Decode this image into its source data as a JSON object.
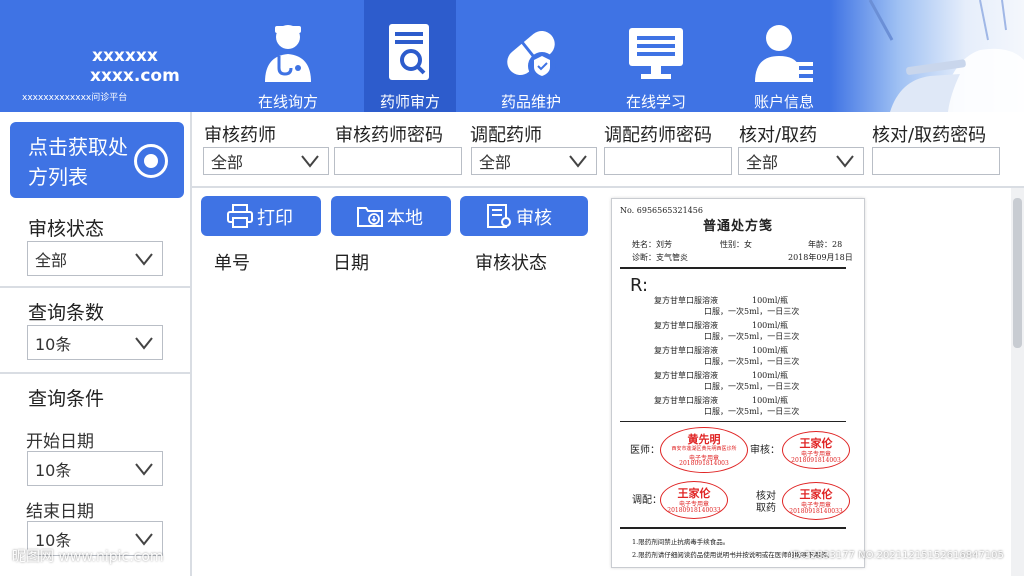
{
  "header": {
    "brand_line1": "xxxxxx",
    "brand_line2": "xxxx.com",
    "brand_sub": "xxxxxxxxxxxxx问诊平台",
    "nav": [
      {
        "label": "在线询方",
        "icon": "doctor-icon",
        "active": false
      },
      {
        "label": "药师审方",
        "icon": "prescription-review-icon",
        "active": true
      },
      {
        "label": "药品维护",
        "icon": "pill-icon",
        "active": false
      },
      {
        "label": "在线学习",
        "icon": "monitor-icon",
        "active": false
      },
      {
        "label": "账户信息",
        "icon": "user-icon",
        "active": false
      }
    ]
  },
  "sidebar": {
    "fetch_button": "点击获取处方列表",
    "review_status_label": "审核状态",
    "review_status_value": "全部",
    "query_count_label": "查询条数",
    "query_count_value": "10条",
    "query_conditions_label": "查询条件",
    "start_date_label": "开始日期",
    "start_date_value": "10条",
    "end_date_label": "结束日期",
    "end_date_value": "10条"
  },
  "filters": {
    "reviewer_label": "审核药师",
    "reviewer_value": "全部",
    "reviewer_password_label": "审核药师密码",
    "dispenser_label": "调配药师",
    "dispenser_value": "全部",
    "dispenser_password_label": "调配药师密码",
    "checker_label": "核对/取药",
    "checker_value": "全部",
    "checker_password_label": "核对/取药密码"
  },
  "actions": {
    "print": "打印",
    "local": "本地",
    "review": "审核"
  },
  "table": {
    "columns": [
      "单号",
      "日期",
      "审核状态"
    ]
  },
  "prescription": {
    "number": "No. 6956565321456",
    "title": "普通处方笺",
    "name": "姓名：刘芳",
    "gender": "性别：女",
    "age": "年龄：28",
    "diagnosis": "诊断：支气管炎",
    "date": "2018年09月18日",
    "rx_symbol": "R:",
    "items": [
      {
        "name": "复方甘草口服溶液",
        "amount": "100ml/瓶",
        "usage": "口服，一次5ml，一日三次"
      },
      {
        "name": "复方甘草口服溶液",
        "amount": "100ml/瓶",
        "usage": "口服，一次5ml，一日三次"
      },
      {
        "name": "复方甘草口服溶液",
        "amount": "100ml/瓶",
        "usage": "口服，一次5ml，一日三次"
      },
      {
        "name": "复方甘草口服溶液",
        "amount": "100ml/瓶",
        "usage": "口服，一次5ml，一日三次"
      },
      {
        "name": "复方甘草口服溶液",
        "amount": "100ml/瓶",
        "usage": "口服，一次5ml，一日三次"
      }
    ],
    "doctor_label": "医师：",
    "review_label": "审核：",
    "dispense_label": "调配：",
    "check_label_1": "核对",
    "check_label_2": "取药",
    "doctor_stamp": {
      "name": "黄先明",
      "line1": "西安市莲湖区黄先明西医诊所",
      "line2": "电子专用章",
      "line3": "2018091814003"
    },
    "review_stamp": {
      "name": "王家伦",
      "line1": "电子专用章",
      "line2": "2018091814003"
    },
    "dispense_stamp": {
      "name": "王家伦",
      "line1": "电子专用章",
      "line2": "20180918140033"
    },
    "check_stamp": {
      "name": "王家伦",
      "line1": "电子专用章",
      "line2": "20180918140033"
    },
    "note1": "1.限药剂间禁止抗病毒手续食品。",
    "note2": "2.限药剂请仔细阅读药品使用说明书并按说明或在医师的指导下用药。"
  },
  "watermark": {
    "left": "昵图网 www.nipic.com",
    "right": "ID:32833177 NO:20211215152616847105"
  },
  "colors": {
    "primary": "#3f73e4",
    "primary_active": "#2d5ccc",
    "stamp_red": "#e02525"
  }
}
